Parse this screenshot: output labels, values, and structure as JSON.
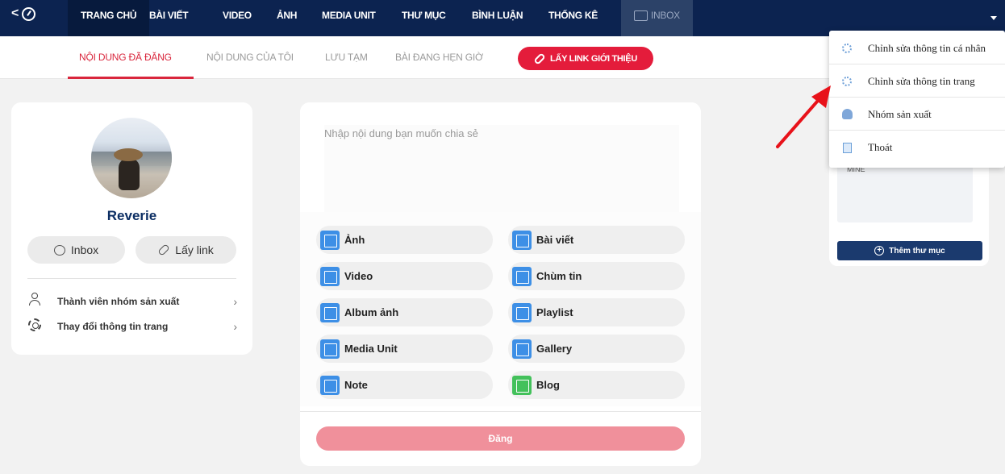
{
  "topnav": {
    "items": [
      "TRANG CHỦ",
      "BÀI VIẾT",
      "VIDEO",
      "ẢNH",
      "MEDIA UNIT",
      "THƯ MỤC",
      "BÌNH LUẬN",
      "THỐNG KÊ"
    ],
    "inbox_label": "INBOX",
    "colors": {
      "bg": "#0c2350",
      "active": "#071a3d"
    }
  },
  "subtabs": {
    "items": [
      "NỘI DUNG ĐÃ ĐĂNG",
      "NỘI DUNG CỦA TÔI",
      "LƯU TẠM",
      "BÀI ĐANG HẸN GIỜ"
    ],
    "active_index": 0,
    "link_button": "LẤY LINK GIỚI THIỆU",
    "accent": "#d9263c"
  },
  "profile": {
    "name": "Reverie",
    "inbox_button": "Inbox",
    "link_button": "Lấy link",
    "menu": [
      {
        "label": "Thành viên nhóm sản xuất",
        "icon": "user-icon"
      },
      {
        "label": "Thay đổi thông tin trang",
        "icon": "gear-icon"
      }
    ]
  },
  "composer": {
    "placeholder": "Nhập nội dung bạn muốn chia sẻ",
    "options": [
      {
        "label": "Ảnh",
        "icon": "image-icon"
      },
      {
        "label": "Bài viết",
        "icon": "article-icon"
      },
      {
        "label": "Video",
        "icon": "video-icon"
      },
      {
        "label": "Chùm tin",
        "icon": "news-cluster-icon"
      },
      {
        "label": "Album ảnh",
        "icon": "album-icon"
      },
      {
        "label": "Playlist",
        "icon": "playlist-icon"
      },
      {
        "label": "Media Unit",
        "icon": "media-unit-icon"
      },
      {
        "label": "Gallery",
        "icon": "gallery-icon"
      },
      {
        "label": "Note",
        "icon": "note-icon"
      },
      {
        "label": "Blog",
        "icon": "blog-icon"
      }
    ],
    "post_button": "Đăng",
    "post_color": "#f0909b"
  },
  "rightcard": {
    "box_text": "MINE",
    "button": "Thêm thư mục"
  },
  "dropdown": {
    "items": [
      {
        "label": "Chỉnh sửa thông tin cá nhân",
        "icon": "gears-icon"
      },
      {
        "label": "Chỉnh sửa thông tin trang",
        "icon": "gears-icon"
      },
      {
        "label": "Nhóm sản xuất",
        "icon": "group-icon"
      },
      {
        "label": "Thoát",
        "icon": "exit-icon"
      }
    ]
  },
  "annotation": {
    "arrow_color": "#e8121a"
  }
}
